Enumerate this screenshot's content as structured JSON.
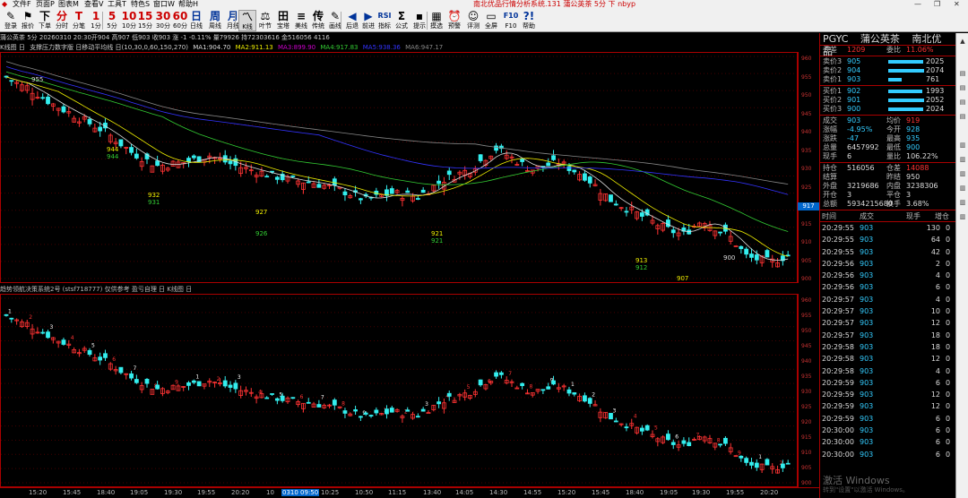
{
  "menu": {
    "items": [
      "文件F",
      "页面P",
      "图表M",
      "查看V",
      "工具T",
      "特色S",
      "窗口W",
      "帮助H"
    ],
    "title": "南北优品行情分析系统.131 蒲公英茶 5分 下 nbyp"
  },
  "toolbar": [
    {
      "g": "✎",
      "l": "登录",
      "c": ""
    },
    {
      "g": "⚑",
      "l": "报价",
      "c": ""
    },
    {
      "g": "下",
      "l": "下单",
      "c": ""
    },
    {
      "g": "分",
      "l": "分时",
      "c": "red"
    },
    {
      "g": "T",
      "l": "分笔",
      "c": "red"
    },
    {
      "g": "1",
      "l": "1分",
      "c": "red"
    },
    {
      "g": "5",
      "l": "5分",
      "c": "red"
    },
    {
      "g": "10",
      "l": "10分",
      "c": "red"
    },
    {
      "g": "15",
      "l": "15分",
      "c": "red"
    },
    {
      "g": "30",
      "l": "30分",
      "c": "red"
    },
    {
      "g": "60",
      "l": "60分",
      "c": "red"
    },
    {
      "g": "日",
      "l": "日线",
      "c": "blue"
    },
    {
      "g": "周",
      "l": "周线",
      "c": "blue"
    },
    {
      "g": "月",
      "l": "月线",
      "c": "blue"
    },
    {
      "g": "〽",
      "l": "K线",
      "c": "",
      "sel": true
    },
    {
      "g": "⚖",
      "l": "叶节",
      "c": ""
    },
    {
      "g": "田",
      "l": "宝塔",
      "c": ""
    },
    {
      "g": "≡",
      "l": "美线",
      "c": ""
    },
    {
      "g": "传",
      "l": "传统",
      "c": ""
    },
    {
      "g": "✎",
      "l": "画线",
      "c": ""
    },
    {
      "g": "◀",
      "l": "后退",
      "c": "blue"
    },
    {
      "g": "▶",
      "l": "前进",
      "c": "blue"
    },
    {
      "g": "RSI",
      "l": "指标",
      "c": "blue"
    },
    {
      "g": "Σ",
      "l": "公式",
      "c": ""
    },
    {
      "g": "▪",
      "l": "提示",
      "c": ""
    },
    {
      "g": "▦",
      "l": "摸选",
      "c": ""
    },
    {
      "g": "⏰",
      "l": "预警",
      "c": ""
    },
    {
      "g": "☺",
      "l": "评测",
      "c": ""
    },
    {
      "g": "▭",
      "l": "全屏",
      "c": ""
    },
    {
      "g": "F10",
      "l": "F10",
      "c": "blue"
    },
    {
      "g": "?!",
      "l": "帮助",
      "c": "blue"
    }
  ],
  "quote_header": {
    "line": "蒲公英茶 5分 20260310 20:30开904 高907 低903 收903 涨 -1 -0.11% 量79926 持72303616 金516056 4116"
  },
  "panel1_header": {
    "title": "K线图 日",
    "indicator": "支撑压力数字版 日移动平均线 日(10,30,0,60,150,270)",
    "ma1": "MA1:904.70",
    "ma2": "MA2:911.13",
    "ma3": "MA3:899.90",
    "ma4": "MA4:917.83",
    "ma5": "MA5:938.36",
    "ma6": "MA6:947.17"
  },
  "panel2_header": {
    "text": "趋势领航决策系统2号 (stsf718777) 仅供参考 盈亏自理 日 K线图 日"
  },
  "chart_data": {
    "type": "candlestick",
    "y_ticks_top": [
      960,
      955,
      950,
      945,
      940,
      935,
      930,
      925,
      920,
      915,
      910,
      905,
      900
    ],
    "y_ticks_bottom": [
      960,
      955,
      950,
      945,
      940,
      935,
      930,
      925,
      920,
      915,
      910,
      905,
      900
    ],
    "current_price_tag": "917",
    "support_labels": [
      {
        "text": "955",
        "color": "white"
      },
      {
        "text": "944",
        "color": "yellow"
      },
      {
        "text": "944",
        "color": "green"
      },
      {
        "text": "932",
        "color": "yellow"
      },
      {
        "text": "931",
        "color": "green"
      },
      {
        "text": "927",
        "color": "yellow"
      },
      {
        "text": "926",
        "color": "green"
      },
      {
        "text": "921",
        "color": "yellow"
      },
      {
        "text": "921",
        "color": "green"
      },
      {
        "text": "913",
        "color": "yellow"
      },
      {
        "text": "912",
        "color": "green"
      },
      {
        "text": "907",
        "color": "yellow"
      },
      {
        "text": "900",
        "color": "white"
      }
    ],
    "time_labels": [
      "15:20",
      "15:45",
      "18:40",
      "19:05",
      "19:30",
      "19:55",
      "20:20",
      "10",
      "0310 09:50",
      "10:25",
      "10:50",
      "11:15",
      "13:40",
      "14:05",
      "14:30",
      "14:55",
      "15:20",
      "15:45",
      "18:40",
      "19:05",
      "19:30",
      "19:55",
      "20:20"
    ]
  },
  "right_panel": {
    "code": "PGYC",
    "name": "蒲公英茶",
    "brand": "南北优品",
    "weicha_label": "委差",
    "weicha": "1209",
    "weibi_label": "委比",
    "weibi": "11.06%",
    "asks": [
      {
        "label": "卖价3",
        "price": "905",
        "vol": "2025",
        "bar": 0.98
      },
      {
        "label": "卖价2",
        "price": "904",
        "vol": "2074",
        "bar": 1.0
      },
      {
        "label": "卖价1",
        "price": "903",
        "vol": "761",
        "bar": 0.37
      }
    ],
    "bids": [
      {
        "label": "买价1",
        "price": "902",
        "vol": "1993",
        "bar": 0.96
      },
      {
        "label": "买价2",
        "price": "901",
        "vol": "2052",
        "bar": 0.99
      },
      {
        "label": "买价3",
        "price": "900",
        "vol": "2024",
        "bar": 0.98
      }
    ],
    "stats": [
      {
        "a": "成交",
        "b": "903",
        "bc": "cyn",
        "c": "均价",
        "d": "919",
        "dc": "red"
      },
      {
        "a": "涨幅",
        "b": "-4.95%",
        "bc": "cyn",
        "c": "今开",
        "d": "928",
        "dc": "cyn"
      },
      {
        "a": "涨跌",
        "b": "-47",
        "bc": "cyn",
        "c": "最高",
        "d": "935",
        "dc": "cyn"
      },
      {
        "a": "总量",
        "b": "6457992",
        "bc": "wht",
        "c": "最低",
        "d": "900",
        "dc": "cyn"
      },
      {
        "a": "现手",
        "b": "6",
        "bc": "wht",
        "c": "量比",
        "d": "106.22%",
        "dc": "wht"
      }
    ],
    "stats2": [
      {
        "a": "持仓",
        "b": "516056",
        "bc": "wht",
        "c": "仓差",
        "d": "14088",
        "dc": "red"
      },
      {
        "a": "结算",
        "b": "",
        "bc": "wht",
        "c": "昨结",
        "d": "950",
        "dc": "wht"
      },
      {
        "a": "外盘",
        "b": "3219686",
        "bc": "wht",
        "c": "内盘",
        "d": "3238306",
        "dc": "wht"
      },
      {
        "a": "开仓",
        "b": "3",
        "bc": "wht",
        "c": "平仓",
        "d": "3",
        "dc": "wht"
      },
      {
        "a": "总额",
        "b": "5934215680",
        "bc": "wht",
        "c": "换手",
        "d": "3.68%",
        "dc": "wht"
      }
    ],
    "ticks_header": {
      "time": "时间",
      "price": "成交",
      "vol": "现手",
      "oi": "增仓"
    },
    "ticks": [
      {
        "t": "20:29:55",
        "p": "903",
        "v": "130",
        "o": "0"
      },
      {
        "t": "20:29:55",
        "p": "903",
        "v": "64",
        "o": "0"
      },
      {
        "t": "20:29:55",
        "p": "903",
        "v": "42",
        "o": "0"
      },
      {
        "t": "20:29:56",
        "p": "903",
        "v": "2",
        "o": "0"
      },
      {
        "t": "20:29:56",
        "p": "903",
        "v": "4",
        "o": "0"
      },
      {
        "t": "20:29:56",
        "p": "903",
        "v": "6",
        "o": "0"
      },
      {
        "t": "20:29:57",
        "p": "903",
        "v": "4",
        "o": "0"
      },
      {
        "t": "20:29:57",
        "p": "903",
        "v": "10",
        "o": "0"
      },
      {
        "t": "20:29:57",
        "p": "903",
        "v": "12",
        "o": "0"
      },
      {
        "t": "20:29:57",
        "p": "903",
        "v": "18",
        "o": "0"
      },
      {
        "t": "20:29:58",
        "p": "903",
        "v": "18",
        "o": "0"
      },
      {
        "t": "20:29:58",
        "p": "903",
        "v": "12",
        "o": "0"
      },
      {
        "t": "20:29:58",
        "p": "903",
        "v": "4",
        "o": "0"
      },
      {
        "t": "20:29:59",
        "p": "903",
        "v": "6",
        "o": "0"
      },
      {
        "t": "20:29:59",
        "p": "903",
        "v": "12",
        "o": "0"
      },
      {
        "t": "20:29:59",
        "p": "903",
        "v": "12",
        "o": "0"
      },
      {
        "t": "20:29:59",
        "p": "903",
        "v": "6",
        "o": "0"
      },
      {
        "t": "20:30:00",
        "p": "903",
        "v": "6",
        "o": "0"
      },
      {
        "t": "20:30:00",
        "p": "903",
        "v": "6",
        "o": "0"
      },
      {
        "t": "20:30:00",
        "p": "903",
        "v": "6",
        "o": "0"
      }
    ]
  },
  "overlay": {
    "watermark": "激活 Windows",
    "watermark_sub": "转到\"设置\"以激活 Windows。"
  }
}
